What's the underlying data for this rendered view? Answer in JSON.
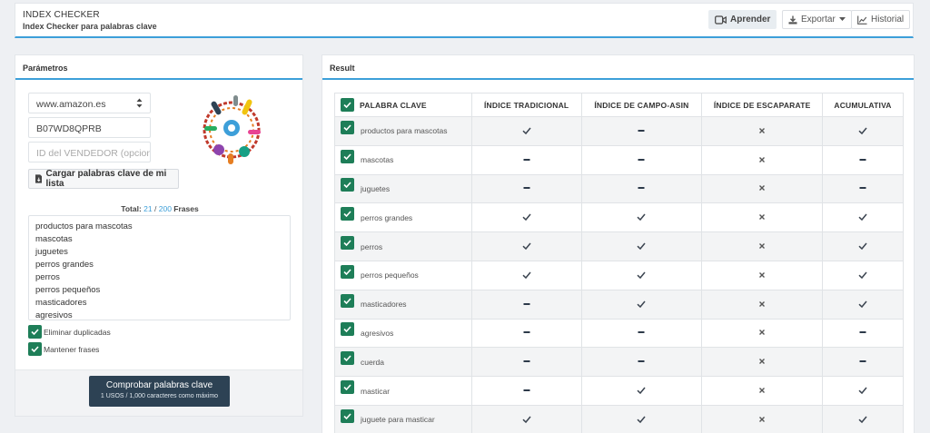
{
  "header": {
    "title": "INDEX CHECKER",
    "subtitle": "Index Checker para palabras clave",
    "learn_label": "Aprender",
    "export_label": "Exportar",
    "history_label": "Historial"
  },
  "params": {
    "title": "Parámetros",
    "marketplace": "www.amazon.es",
    "asin": "B07WD8QPRB",
    "seller_placeholder": "ID del VENDEDOR (opcional",
    "load_label": "Cargar palabras clave de mi lista",
    "total_label": "Total:",
    "total_count": "21",
    "total_sep": " / ",
    "total_max": "200",
    "total_unit": "Frases",
    "keywords": [
      "productos para mascotas",
      "mascotas",
      "juguetes",
      "perros grandes",
      "perros",
      "perros pequeños",
      "masticadores",
      "agresivos"
    ],
    "remove_duplicates_label": "Eliminar duplicadas",
    "keep_phrases_label": "Mantener frases",
    "check_label": "Comprobar palabras clave",
    "check_sublabel": "1 USOS / 1,000 caracteres como máximo"
  },
  "result": {
    "title": "Result",
    "columns": [
      "PALABRA CLAVE",
      "ÍNDICE TRADICIONAL",
      "ÍNDICE DE CAMPO-ASIN",
      "ÍNDICE DE ESCAPARATE",
      "ACUMULATIVA"
    ],
    "rows": [
      {
        "keyword": "productos para mascotas",
        "traditional": "check",
        "campo_asin": "dash",
        "escaparate": "cross",
        "acumulativa": "check"
      },
      {
        "keyword": "mascotas",
        "traditional": "dash",
        "campo_asin": "dash",
        "escaparate": "cross",
        "acumulativa": "dash"
      },
      {
        "keyword": "juguetes",
        "traditional": "dash",
        "campo_asin": "dash",
        "escaparate": "cross",
        "acumulativa": "dash"
      },
      {
        "keyword": "perros grandes",
        "traditional": "check",
        "campo_asin": "check",
        "escaparate": "cross",
        "acumulativa": "check"
      },
      {
        "keyword": "perros",
        "traditional": "check",
        "campo_asin": "check",
        "escaparate": "cross",
        "acumulativa": "check"
      },
      {
        "keyword": "perros pequeños",
        "traditional": "check",
        "campo_asin": "check",
        "escaparate": "cross",
        "acumulativa": "check"
      },
      {
        "keyword": "masticadores",
        "traditional": "dash",
        "campo_asin": "check",
        "escaparate": "cross",
        "acumulativa": "check"
      },
      {
        "keyword": "agresivos",
        "traditional": "dash",
        "campo_asin": "dash",
        "escaparate": "cross",
        "acumulativa": "dash"
      },
      {
        "keyword": "cuerda",
        "traditional": "dash",
        "campo_asin": "dash",
        "escaparate": "cross",
        "acumulativa": "dash"
      },
      {
        "keyword": "masticar",
        "traditional": "dash",
        "campo_asin": "check",
        "escaparate": "cross",
        "acumulativa": "check"
      },
      {
        "keyword": "juguete para masticar",
        "traditional": "check",
        "campo_asin": "check",
        "escaparate": "cross",
        "acumulativa": "check"
      }
    ]
  },
  "colors": {
    "accent": "#3d9fd9",
    "checkbox": "#1e7e58",
    "primary_button": "#2d4254"
  }
}
